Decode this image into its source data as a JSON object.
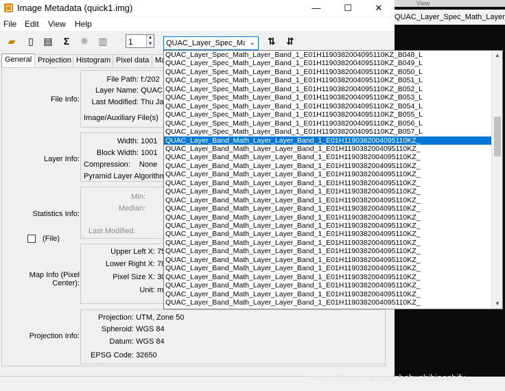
{
  "window": {
    "title": "Image Metadata (quick1.img)",
    "controls": {
      "minimize": "—",
      "maximize": "☐",
      "close": "✕"
    }
  },
  "menu": [
    "File",
    "Edit",
    "View",
    "Help"
  ],
  "toolbar": {
    "page_number": "1",
    "layer_select": "QUAC_Layer_Spec_Matl"
  },
  "tabs": [
    "General",
    "Projection",
    "Histogram",
    "Pixel data",
    "Ma"
  ],
  "file_info": {
    "section_label": "File Info:",
    "file_path_label": "File Path:",
    "file_path_value": "f:/202",
    "layer_name_label": "Layer Name:",
    "layer_name_value": "QUAC",
    "last_modified_label": "Last Modified:",
    "last_modified_value": "Thu Ja",
    "aux_files_label": "Image/Auxiliary File(s)"
  },
  "layer_info": {
    "section_label": "Layer Info:",
    "width_label": "Width:",
    "width_value": "1001",
    "block_width_label": "Block Width:",
    "block_width_value": "1001",
    "compression_label": "Compression:",
    "compression_value": "None",
    "pyramid_label": "Pyramid Layer Algorithm:"
  },
  "statistics_info": {
    "section_label": "Statistics Info:",
    "min_label": "Min:",
    "median_label": "Median:",
    "last_modified_label": "Last Modified:",
    "file_checkbox_label": "(File)"
  },
  "map_info": {
    "section_label": "Map Info (Pixel Center):",
    "upper_left_label": "Upper Left X:",
    "upper_left_value": "75",
    "lower_right_label": "Lower Right X:",
    "lower_right_value": "78",
    "pixel_size_label": "Pixel Size X:",
    "pixel_size_value": "30",
    "unit_label": "Unit:",
    "unit_value": "m"
  },
  "projection_info": {
    "section_label": "Projection Info:",
    "projection_label": "Projection:",
    "projection_value": "UTM, Zone 50",
    "spheroid_label": "Spheroid:",
    "spheroid_value": "WGS 84",
    "datum_label": "Datum:",
    "datum_value": "WGS 84",
    "epsg_label": "EPSG Code:",
    "epsg_value": "32650"
  },
  "dropdown_items": [
    "QUAC_Layer_Spec_Math_Layer_Band_1_E01H1190382004095110KZ_B048_L",
    "QUAC_Layer_Spec_Math_Layer_Band_1_E01H1190382004095110KZ_B049_L",
    "QUAC_Layer_Spec_Math_Layer_Band_1_E01H1190382004095110KZ_B050_L",
    "QUAC_Layer_Spec_Math_Layer_Band_1_E01H1190382004095110KZ_B051_L",
    "QUAC_Layer_Spec_Math_Layer_Band_1_E01H1190382004095110KZ_B052_L",
    "QUAC_Layer_Spec_Math_Layer_Band_1_E01H1190382004095110KZ_B053_L",
    "QUAC_Layer_Spec_Math_Layer_Band_1_E01H1190382004095110KZ_B054_L",
    "QUAC_Layer_Spec_Math_Layer_Band_1_E01H1190382004095110KZ_B055_L",
    "QUAC_Layer_Spec_Math_Layer_Band_1_E01H1190382004095110KZ_B056_L",
    "QUAC_Layer_Spec_Math_Layer_Band_1_E01H1190382004095110KZ_B057_L",
    "QUAC_Layer_Band_Math_Layer_Layer_Band_1_E01H1190382004095110KZ_",
    "QUAC_Layer_Band_Math_Layer_Layer_Band_1_E01H1190382004095110KZ_",
    "QUAC_Layer_Band_Math_Layer_Layer_Band_1_E01H1190382004095110KZ_",
    "QUAC_Layer_Band_Math_Layer_Layer_Band_1_E01H1190382004095110KZ_",
    "QUAC_Layer_Band_Math_Layer_Layer_Band_1_E01H1190382004095110KZ_",
    "QUAC_Layer_Band_Math_Layer_Layer_Band_1_E01H1190382004095110KZ_",
    "QUAC_Layer_Band_Math_Layer_Layer_Band_1_E01H1190382004095110KZ_",
    "QUAC_Layer_Band_Math_Layer_Layer_Band_1_E01H1190382004095110KZ_",
    "QUAC_Layer_Band_Math_Layer_Layer_Band_1_E01H1190382004095110KZ_",
    "QUAC_Layer_Band_Math_Layer_Layer_Band_1_E01H1190382004095110KZ_",
    "QUAC_Layer_Band_Math_Layer_Layer_Band_1_E01H1190382004095110KZ_",
    "QUAC_Layer_Band_Math_Layer_Layer_Band_1_E01H1190382004095110KZ_",
    "QUAC_Layer_Band_Math_Layer_Layer_Band_1_E01H1190382004095110KZ_",
    "QUAC_Layer_Band_Math_Layer_Layer_Band_1_E01H1190382004095110KZ_",
    "QUAC_Layer_Band_Math_Layer_Layer_Band_1_E01H1190382004095110KZ_",
    "QUAC_Layer_Band_Math_Layer_Layer_Band_1_E01H1190382004095110KZ_",
    "QUAC_Layer_Band_Math_Layer_Layer_Band_1_E01H1190382004095110KZ_",
    "QUAC_Layer_Band_Math_Layer_Layer_Band_1_E01H1190382004095110KZ_",
    "QUAC_Layer_Band_Math_Layer_Layer_Band_1_E01H1190382004095110KZ_",
    "QUAC_Layer_Band_Math_Layer_Layer_Band_1_E01H1190382004095110KZ_"
  ],
  "dropdown_selected": 10,
  "background_app": {
    "top_label": "View",
    "tab_text": "QUAC_Layer_Spec_Math_Layer_Ban"
  },
  "watermark": "https://blog.csdn.net/zhebushibiaoshifu",
  "colors": {
    "selection": "#0078d7",
    "icon_accent": "#e28a1c"
  }
}
